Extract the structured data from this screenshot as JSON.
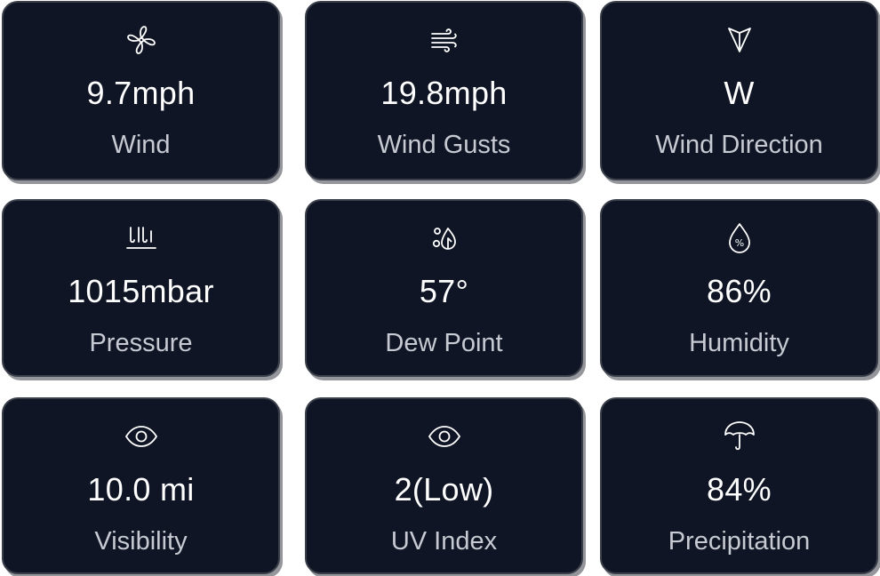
{
  "cards": [
    {
      "icon": "fan-icon",
      "value": "9.7mph",
      "label": "Wind"
    },
    {
      "icon": "wind-gust-icon",
      "value": "19.8mph",
      "label": "Wind Gusts"
    },
    {
      "icon": "navigation-arrow-icon",
      "value": "W",
      "label": "Wind Direction"
    },
    {
      "icon": "pressure-icon",
      "value": "1015mbar",
      "label": "Pressure"
    },
    {
      "icon": "dew-point-icon",
      "value": "57°",
      "label": "Dew Point"
    },
    {
      "icon": "humidity-drop-icon",
      "value": "86%",
      "label": "Humidity"
    },
    {
      "icon": "eye-icon",
      "value": "10.0 mi",
      "label": "Visibility"
    },
    {
      "icon": "eye-icon",
      "value": "2(Low)",
      "label": "UV Index"
    },
    {
      "icon": "umbrella-icon",
      "value": "84%",
      "label": "Precipitation"
    }
  ],
  "colors": {
    "card_background": "#0f1524",
    "card_border": "#3a3f4a",
    "value_text": "#ffffff",
    "label_text": "#c7cad2"
  }
}
